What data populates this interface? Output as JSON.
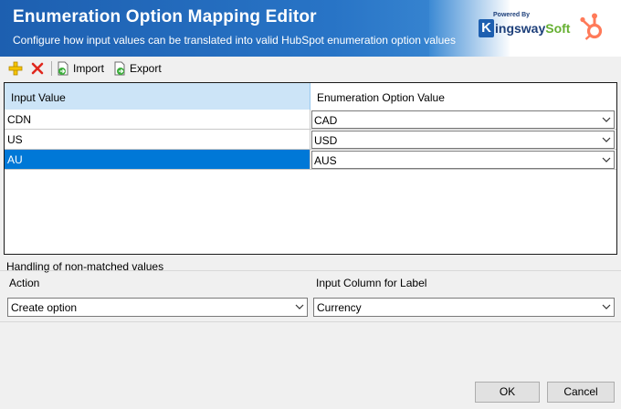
{
  "header": {
    "title": "Enumeration Option Mapping Editor",
    "subtitle": "Configure how input values can be translated into valid HubSpot enumeration option values",
    "brand_powered": "Powered By",
    "brand_k": "K",
    "brand_name_main": "ingsway",
    "brand_name_soft": "Soft",
    "brand_color": "#1d3f7a",
    "brand_accent": "#66b032",
    "hubspot_color": "#ff7a59"
  },
  "toolbar": {
    "add_icon": "add-plus-icon",
    "delete_icon": "delete-x-icon",
    "import_label": "Import",
    "export_label": "Export"
  },
  "grid": {
    "columns": [
      "Input Value",
      "Enumeration Option Value"
    ],
    "rows": [
      {
        "input": "CDN",
        "option": "CAD",
        "selected": false
      },
      {
        "input": "US",
        "option": "USD",
        "selected": false
      },
      {
        "input": "AU",
        "option": "AUS",
        "selected": true
      }
    ]
  },
  "handling": {
    "group_label": "Handling of non-matched values",
    "action_label": "Action",
    "action_value": "Create option",
    "column_label": "Input Column for Label",
    "column_value": "Currency"
  },
  "buttons": {
    "ok": "OK",
    "cancel": "Cancel"
  },
  "colors": {
    "selection": "#0078d7",
    "header_selected": "#cce4f7"
  }
}
